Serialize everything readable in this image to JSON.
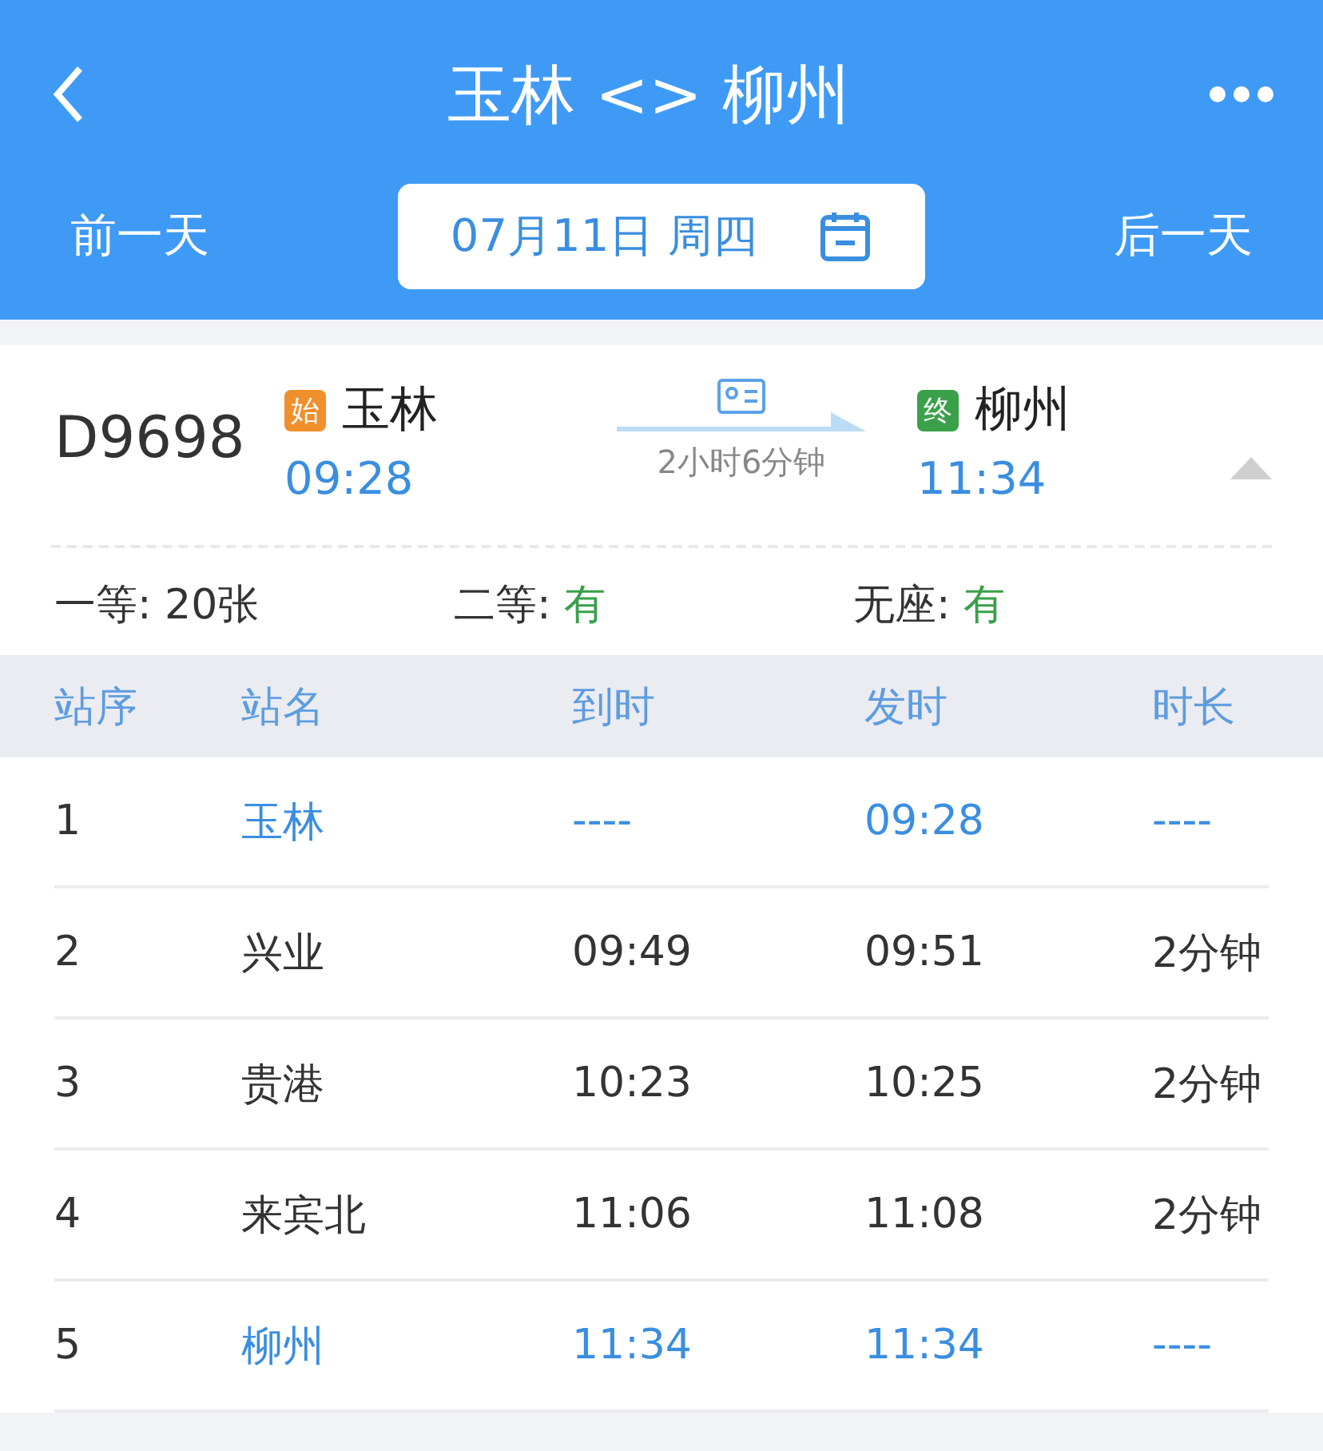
{
  "nav": {
    "title": "玉林 <> 柳州"
  },
  "date_bar": {
    "previous": "前一天",
    "date": "07月11日 周四",
    "next": "后一天"
  },
  "train": {
    "number": "D9698",
    "origin": {
      "badge": "始",
      "station": "玉林",
      "time": "09:28"
    },
    "duration": "2小时6分钟",
    "destination": {
      "badge": "终",
      "station": "柳州",
      "time": "11:34"
    },
    "expanded": true
  },
  "seats": [
    {
      "label": "一等: ",
      "value": "20张",
      "available": false
    },
    {
      "label": "二等: ",
      "value": "有",
      "available": true
    },
    {
      "label": "无座: ",
      "value": "有",
      "available": true
    }
  ],
  "table": {
    "columns": [
      "站序",
      "站名",
      "到时",
      "发时",
      "时长"
    ],
    "rows": [
      {
        "cells": [
          "1",
          "玉林",
          "----",
          "09:28",
          "----"
        ],
        "highlighted": true
      },
      {
        "cells": [
          "2",
          "兴业",
          "09:49",
          "09:51",
          "2分钟"
        ],
        "highlighted": false
      },
      {
        "cells": [
          "3",
          "贵港",
          "10:23",
          "10:25",
          "2分钟"
        ],
        "highlighted": false
      },
      {
        "cells": [
          "4",
          "来宾北",
          "11:06",
          "11:08",
          "2分钟"
        ],
        "highlighted": false
      },
      {
        "cells": [
          "5",
          "柳州",
          "11:34",
          "11:34",
          "----"
        ],
        "highlighted": true
      }
    ]
  }
}
